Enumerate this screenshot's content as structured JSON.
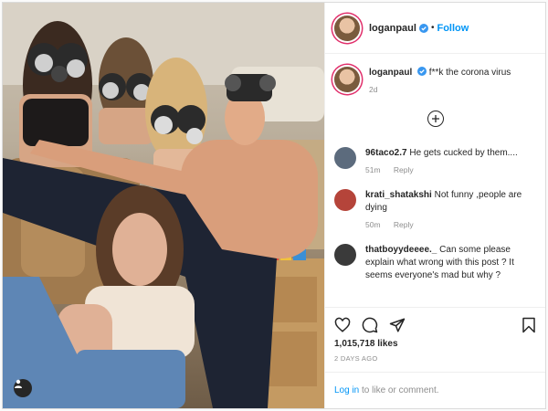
{
  "header": {
    "username": "loganpaul",
    "dot": "•",
    "follow_label": "Follow"
  },
  "caption": {
    "username": "loganpaul",
    "text": "f**k the corona virus",
    "age": "2d"
  },
  "comments": [
    {
      "username": "96taco2.7",
      "text": "He gets cucked by them....",
      "age": "51m",
      "reply": "Reply",
      "avatar_color": "#5c6b7d"
    },
    {
      "username": "krati_shatakshi",
      "text": "Not funny ,people are dying",
      "age": "50m",
      "reply": "Reply",
      "avatar_color": "#b5443a"
    },
    {
      "username": "thatboyydeeee._",
      "text": "Can some please explain what wrong with this post ? It seems everyone's mad but why ?",
      "age": "",
      "reply": "",
      "avatar_color": "#3a3a3a"
    }
  ],
  "actions": {
    "likes": "1,015,718 likes",
    "timestamp": "2 DAYS AGO"
  },
  "login": {
    "link": "Log in",
    "rest": "to like or comment."
  },
  "colors": {
    "accent": "#0095f6",
    "story_ring": "#e1306c"
  },
  "icons": [
    "verified-badge-icon",
    "plus-circle-icon",
    "heart-icon",
    "comment-icon",
    "share-icon",
    "bookmark-icon",
    "user-tag-icon"
  ]
}
